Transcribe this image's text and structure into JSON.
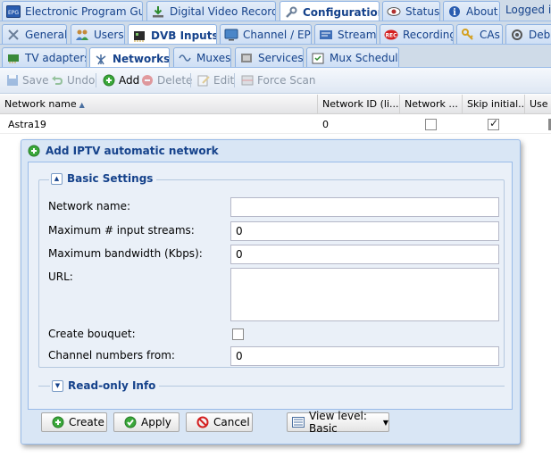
{
  "main_tabs": [
    {
      "label": "Electronic Program Guide",
      "icon": "epg-icon",
      "active": false
    },
    {
      "label": "Digital Video Recorder",
      "icon": "download-icon",
      "active": false
    },
    {
      "label": "Configuration",
      "icon": "wrench-icon",
      "active": true
    },
    {
      "label": "Status",
      "icon": "eye-icon",
      "active": false
    },
    {
      "label": "About",
      "icon": "info-icon",
      "active": false
    }
  ],
  "logged_in": "Logged i",
  "config_tabs": [
    {
      "label": "General",
      "icon": "tools-icon"
    },
    {
      "label": "Users",
      "icon": "users-icon"
    },
    {
      "label": "DVB Inputs",
      "icon": "dvb-card-icon",
      "active": true
    },
    {
      "label": "Channel / EPG",
      "icon": "tv-icon"
    },
    {
      "label": "Stream",
      "icon": "stream-icon"
    },
    {
      "label": "Recording",
      "icon": "rec-icon"
    },
    {
      "label": "CAs",
      "icon": "key-icon"
    },
    {
      "label": "Debu",
      "icon": "debug-icon"
    }
  ],
  "dvb_tabs": [
    {
      "label": "TV adapters",
      "icon": "adapter-icon"
    },
    {
      "label": "Networks",
      "icon": "antenna-icon",
      "active": true
    },
    {
      "label": "Muxes",
      "icon": "mux-icon"
    },
    {
      "label": "Services",
      "icon": "services-icon"
    },
    {
      "label": "Mux Schedulers",
      "icon": "scheduler-icon"
    }
  ],
  "toolbar": {
    "save": "Save",
    "undo": "Undo",
    "add": "Add",
    "delete": "Delete",
    "edit": "Edit",
    "force_scan": "Force Scan"
  },
  "grid": {
    "columns": [
      "Network name",
      "Network ID (li...",
      "Network ...",
      "Skip initial...",
      "Use"
    ],
    "rows": [
      {
        "network_name": "Astra19",
        "network_id": "0",
        "network_checked": false,
        "skip_initial_checked": true
      }
    ]
  },
  "dialog": {
    "title": "Add IPTV automatic network",
    "basic_settings": "Basic Settings",
    "fields": {
      "network_name_label": "Network name:",
      "network_name_value": "",
      "max_streams_label": "Maximum # input streams:",
      "max_streams_value": "0",
      "max_bandwidth_label": "Maximum bandwidth (Kbps):",
      "max_bandwidth_value": "0",
      "url_label": "URL:",
      "url_value": "",
      "create_bouquet_label": "Create bouquet:",
      "create_bouquet_checked": false,
      "channel_numbers_label": "Channel numbers from:",
      "channel_numbers_value": "0"
    },
    "readonly_info": "Read-only Info",
    "buttons": {
      "create": "Create",
      "apply": "Apply",
      "cancel": "Cancel",
      "view_level": "View level: Basic"
    }
  },
  "colors": {
    "accent_text": "#15428b",
    "tab_bar": "#cfdbe8",
    "dialog_bg": "#d9e6f5",
    "border": "#99bbe8"
  }
}
